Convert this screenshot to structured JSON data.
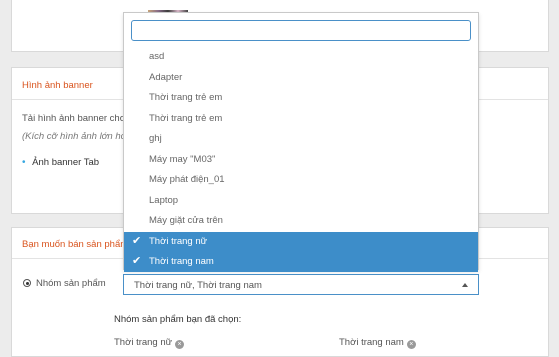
{
  "banner_section": {
    "title": "Hình ảnh banner",
    "text_line": "Tải hình ảnh banner cho c",
    "note": "(Kích cỡ hình ảnh lớn hơn",
    "tab_label": "Ảnh banner Tab"
  },
  "sell_section": {
    "title": "Bạn muốn bán sản phẩm",
    "radio_label": "Nhóm sản phẩm",
    "select_value": "Thời trang nữ, Thời trang nam",
    "chosen_heading": "Nhóm sản phẩm bạn đã chọn:",
    "chosen": [
      "Thời trang nữ",
      "Thời trang nam"
    ]
  },
  "dropdown": {
    "search_value": "",
    "items": [
      {
        "label": "asd",
        "selected": false
      },
      {
        "label": "Adapter",
        "selected": false
      },
      {
        "label": "Thời trang trẻ em",
        "selected": false
      },
      {
        "label": "Thời trang trẻ em",
        "selected": false
      },
      {
        "label": "ghj",
        "selected": false
      },
      {
        "label": "Máy may \"M03\"",
        "selected": false
      },
      {
        "label": "Máy phát điện_01",
        "selected": false
      },
      {
        "label": "Laptop",
        "selected": false
      },
      {
        "label": "Máy giặt cửa trên",
        "selected": false
      },
      {
        "label": "Thời trang nữ",
        "selected": true
      },
      {
        "label": "Thời trang nam",
        "selected": true
      }
    ]
  },
  "colors": {
    "accent": "#d9541e",
    "selected_bg": "#3d8dc9",
    "bullet": "#37a7e0"
  }
}
